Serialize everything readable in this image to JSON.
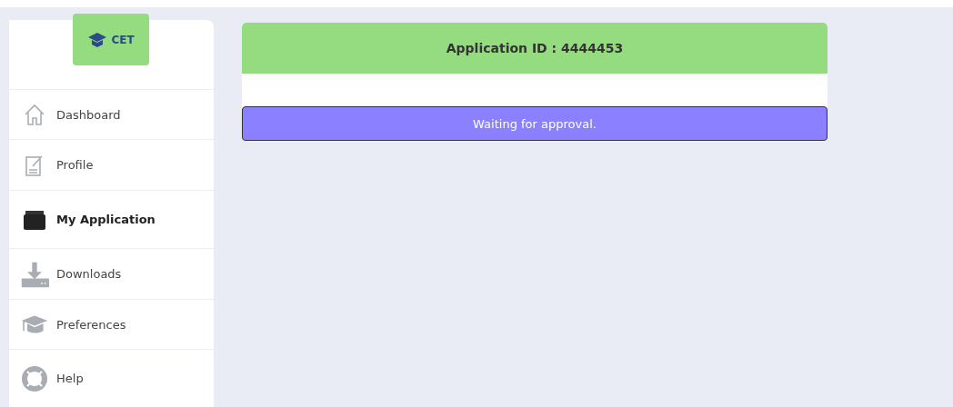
{
  "logo": {
    "text": "CET"
  },
  "sidebar": {
    "items": [
      {
        "label": "Dashboard",
        "selected": false
      },
      {
        "label": "Profile",
        "selected": false
      },
      {
        "label": "My Application",
        "selected": true
      },
      {
        "label": "Downloads",
        "selected": false
      },
      {
        "label": "Preferences",
        "selected": false
      },
      {
        "label": "Help",
        "selected": false
      }
    ]
  },
  "application": {
    "title": "Application ID : 4444453",
    "status": "Waiting for approval."
  }
}
